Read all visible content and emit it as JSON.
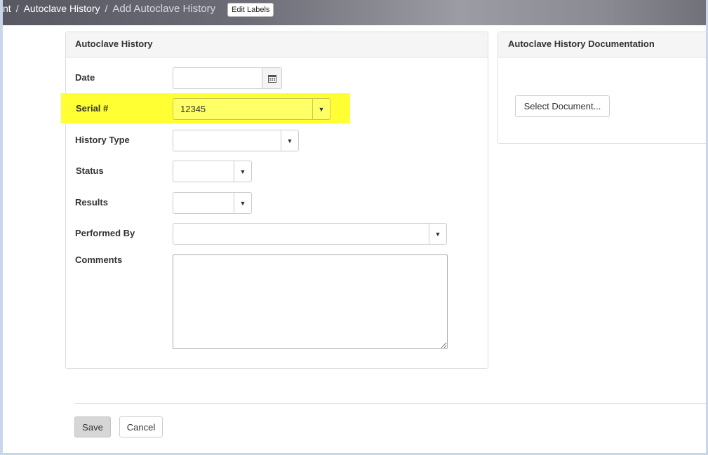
{
  "breadcrumb": {
    "items": [
      "nt",
      "Autoclave History"
    ],
    "current": "Add Autoclave History",
    "separator": "/"
  },
  "toolbar": {
    "edit_labels": "Edit Labels"
  },
  "form_panel": {
    "title": "Autoclave History",
    "fields": {
      "date": {
        "label": "Date",
        "value": "",
        "icon": "calendar-icon"
      },
      "serial": {
        "label": "Serial #",
        "value": "12345",
        "highlight_color": "#ffff33"
      },
      "history_type": {
        "label": "History Type",
        "value": ""
      },
      "status": {
        "label": "Status",
        "value": ""
      },
      "results": {
        "label": "Results",
        "value": ""
      },
      "performed_by": {
        "label": "Performed By",
        "value": ""
      },
      "comments": {
        "label": "Comments",
        "value": ""
      }
    },
    "dropdown_glyph": "▼"
  },
  "docs_panel": {
    "title": "Autoclave History Documentation",
    "select_button": "Select Document..."
  },
  "actions": {
    "save": "Save",
    "cancel": "Cancel"
  }
}
